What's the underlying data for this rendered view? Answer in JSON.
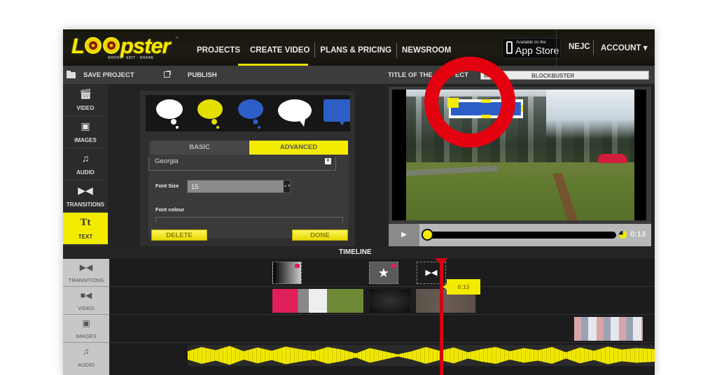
{
  "header": {
    "logo": {
      "prefix": "L",
      "suffix": "pster",
      "tagline": "SHOOT · EDIT · SHARE",
      "trademark": "™"
    },
    "nav": [
      "PROJECTS",
      "CREATE VIDEO",
      "PLANS & PRICING",
      "NEWSROOM"
    ],
    "active_nav": "CREATE VIDEO",
    "app_store": {
      "small": "Available on the",
      "big": "App Store"
    },
    "user": "NEJC",
    "account": "ACCOUNT ▾"
  },
  "toolbar": {
    "save_label": "SAVE PROJECT",
    "publish_label": "PUBLISH",
    "title_label": "TITLE OF THE PROJECT",
    "title_visible_left": "TITLE OF THE",
    "title_visible_right": "ECT",
    "title_value": "MY",
    "title_value_end": "BLOCKBUSTER"
  },
  "sidebar": {
    "items": [
      {
        "label": "VIDEO",
        "icon": "clapper-icon"
      },
      {
        "label": "IMAGES",
        "icon": "image-icon"
      },
      {
        "label": "AUDIO",
        "icon": "music-icon"
      },
      {
        "label": "TRANSITIONS",
        "icon": "bowtie-icon"
      },
      {
        "label": "TEXT",
        "icon": "text-icon",
        "active": true
      }
    ]
  },
  "editor": {
    "bubbles": [
      {
        "type": "thought",
        "color": "#ffffff"
      },
      {
        "type": "thought",
        "color": "#e3e000"
      },
      {
        "type": "thought",
        "color": "#2d5ec8"
      },
      {
        "type": "speech",
        "color": "#ffffff"
      },
      {
        "type": "speech-square",
        "color": "#2d5ec8"
      }
    ],
    "tabs": {
      "basic": "BASIC",
      "advanced": "ADVANCED",
      "active": "ADVANCED"
    },
    "font_family": "Georgia",
    "font_size_label": "Font Size",
    "font_size": "15",
    "font_colour_label": "Font colour",
    "delete_label": "DELETE",
    "done_label": "DONE"
  },
  "preview": {
    "current_time": "0:13",
    "progress": 0.0
  },
  "timeline": {
    "title": "TIMELINE",
    "tracks": [
      "TRANSITIONS",
      "VIDEO",
      "IMAGES",
      "AUDIO"
    ],
    "playhead_time": "0:13"
  },
  "colors": {
    "accent": "#f4ec00",
    "highlight_ring": "#e3000f",
    "playhead": "#d40010"
  }
}
